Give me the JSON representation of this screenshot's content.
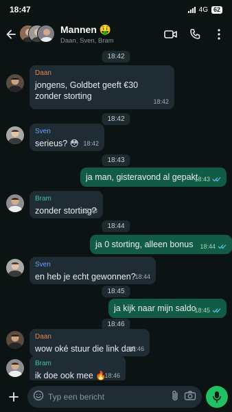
{
  "status": {
    "time": "18:47",
    "network": "4G",
    "battery": "62"
  },
  "header": {
    "title": "Mannen 🤑",
    "subtitle": "Daan, Sven, Bram"
  },
  "colors": {
    "daan": "#e8804f",
    "sven": "#6aa6ff",
    "bram": "#3fc1a5",
    "out_bubble": "#125c45",
    "in_bubble": "#1f2c33"
  },
  "messages": [
    {
      "type": "date",
      "text": "18:42"
    },
    {
      "type": "in",
      "sender": "Daan",
      "text": "jongens, Goldbet geeft €30 zonder storting",
      "time": "18:42"
    },
    {
      "type": "date",
      "text": "18:42"
    },
    {
      "type": "in",
      "sender": "Sven",
      "text": "serieus? 😳",
      "time": "18:42"
    },
    {
      "type": "date",
      "text": "18:43"
    },
    {
      "type": "out",
      "text": "ja man, gisteravond al gepakt",
      "time": "18:43"
    },
    {
      "type": "in",
      "sender": "Bram",
      "text": "zonder storting?",
      "time": "18:43"
    },
    {
      "type": "date",
      "text": "18:44"
    },
    {
      "type": "out",
      "text": "ja 0 storting, alleen bonus",
      "time": "18:44"
    },
    {
      "type": "in",
      "sender": "Sven",
      "text": "en heb je echt gewonnen?",
      "time": "18:44"
    },
    {
      "type": "date",
      "text": "18:45"
    },
    {
      "type": "out",
      "text": "ja kijk naar mijn saldo",
      "time": "18:45"
    },
    {
      "type": "date",
      "text": "18:46"
    },
    {
      "type": "in",
      "sender": "Daan",
      "text": "wow oké stuur die link dan",
      "time": "18:46"
    },
    {
      "type": "in",
      "sender": "Bram",
      "text": "ik doe ook mee 🔥",
      "time": "18:46"
    }
  ],
  "input": {
    "placeholder": "Typ een bericht"
  }
}
